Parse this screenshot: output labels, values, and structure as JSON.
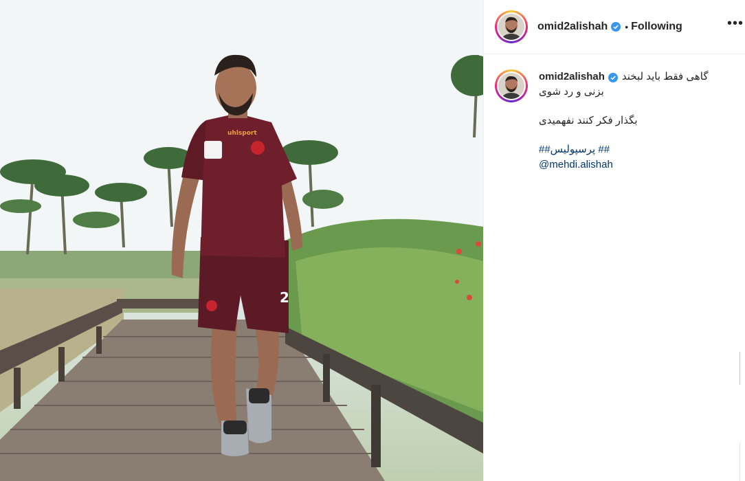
{
  "post": {
    "author": {
      "username": "omid2alishah",
      "verified": true,
      "avatar_icon": "profile-photo"
    },
    "separator": "•",
    "follow_state": "Following",
    "more_icon": "ellipsis-icon",
    "more_label": "•••",
    "caption": {
      "line1": "گاهی فقط باید لبخند",
      "line2": "بزنی و رد شوی",
      "line3": "بگذار فکر کنند نفهمیدی",
      "hashtag": "## پرسپولیس##",
      "mention": "@mehdi.alishah"
    },
    "photo": {
      "subject": "footballer walking on wooden boardwalk",
      "shirt_brand": "uhlsport",
      "shorts_number": "2"
    }
  },
  "colors": {
    "text": "#262626",
    "link": "#00376b",
    "verified": "#3897f0",
    "jersey": "#6e1f2b",
    "divider": "#efefef"
  }
}
